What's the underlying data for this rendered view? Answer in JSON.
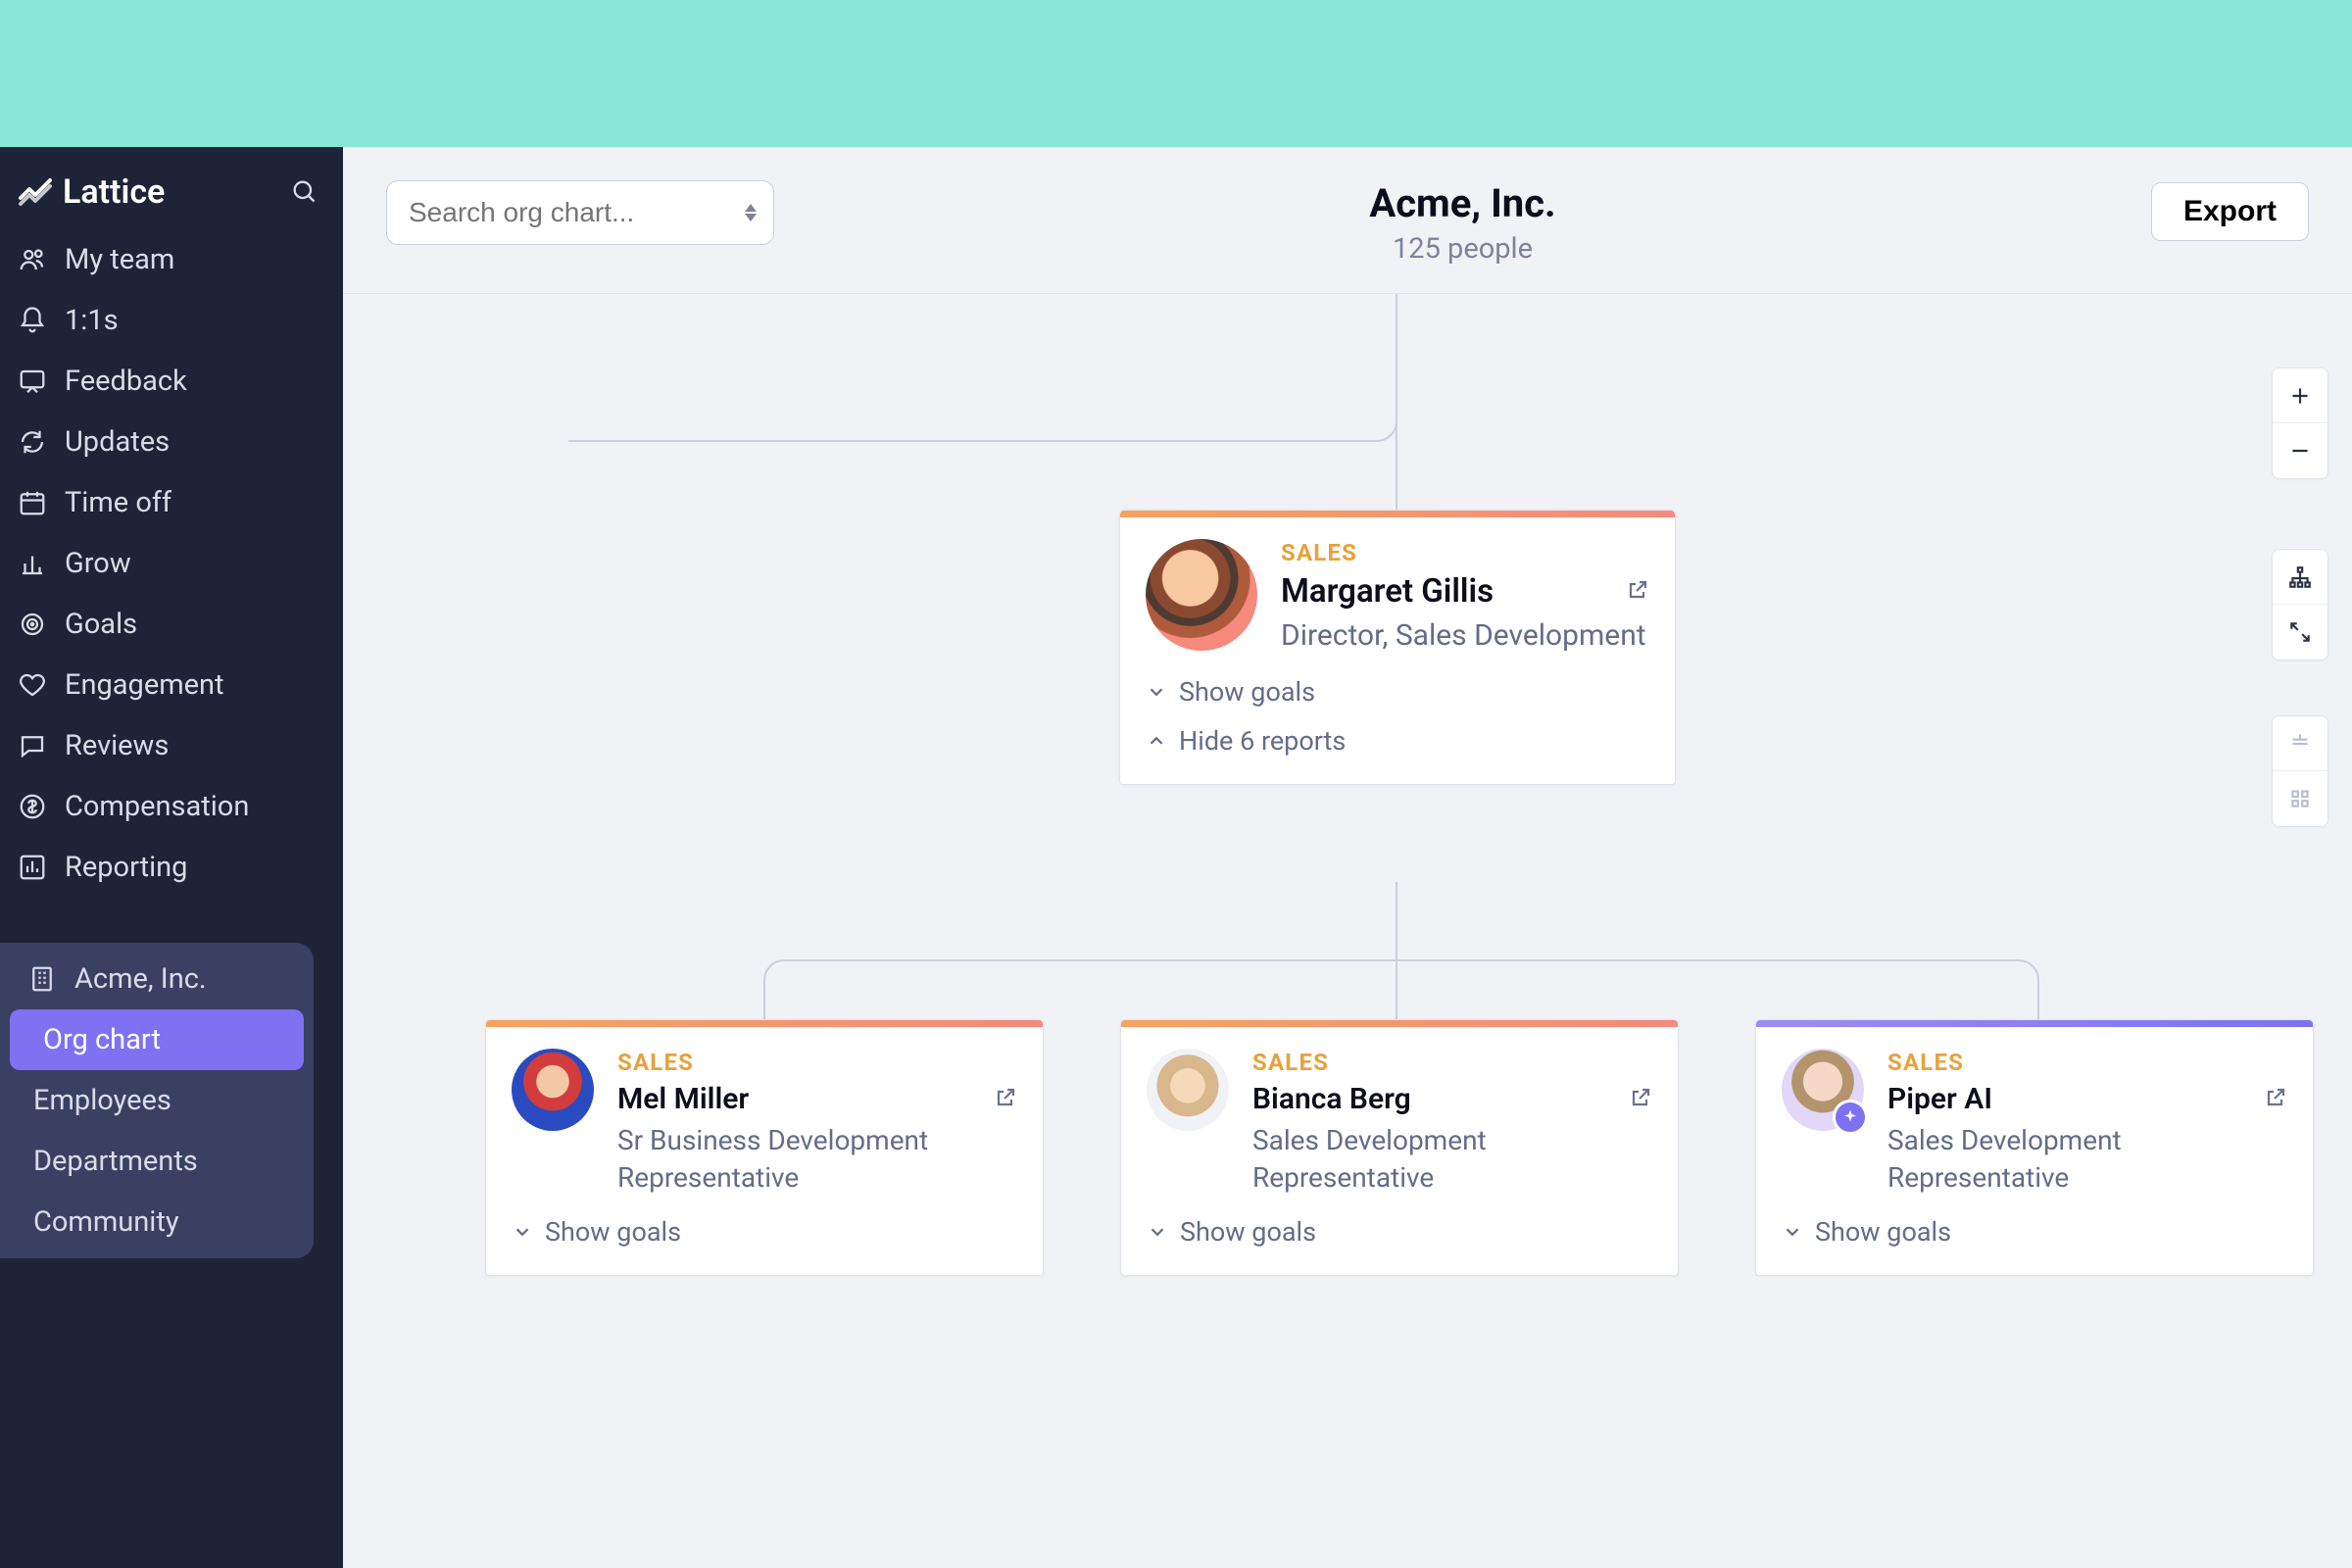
{
  "brand": "Lattice",
  "search": {
    "placeholder": "Search org chart..."
  },
  "header": {
    "title": "Acme, Inc.",
    "subtitle": "125 people"
  },
  "export_label": "Export",
  "sidebar": {
    "items": [
      {
        "label": "My team"
      },
      {
        "label": "1:1s"
      },
      {
        "label": "Feedback"
      },
      {
        "label": "Updates"
      },
      {
        "label": "Time off"
      },
      {
        "label": "Grow"
      },
      {
        "label": "Goals"
      },
      {
        "label": "Engagement"
      },
      {
        "label": "Reviews"
      },
      {
        "label": "Compensation"
      },
      {
        "label": "Reporting"
      }
    ],
    "section": {
      "header": "Acme, Inc.",
      "items": [
        {
          "label": "Org chart"
        },
        {
          "label": "Employees"
        },
        {
          "label": "Departments"
        },
        {
          "label": "Community"
        }
      ]
    }
  },
  "cards": {
    "root": {
      "dept": "SALES",
      "name": "Margaret Gillis",
      "title": "Director, Sales Development",
      "show_goals": "Show goals",
      "hide_reports": "Hide 6 reports"
    },
    "c1": {
      "dept": "SALES",
      "name": "Mel Miller",
      "title": "Sr Business Development Representative",
      "show_goals": "Show goals"
    },
    "c2": {
      "dept": "SALES",
      "name": "Bianca Berg",
      "title": "Sales Development Representative",
      "show_goals": "Show goals"
    },
    "c3": {
      "dept": "SALES",
      "name": "Piper AI",
      "title": "Sales Development Representative",
      "show_goals": "Show goals"
    }
  }
}
